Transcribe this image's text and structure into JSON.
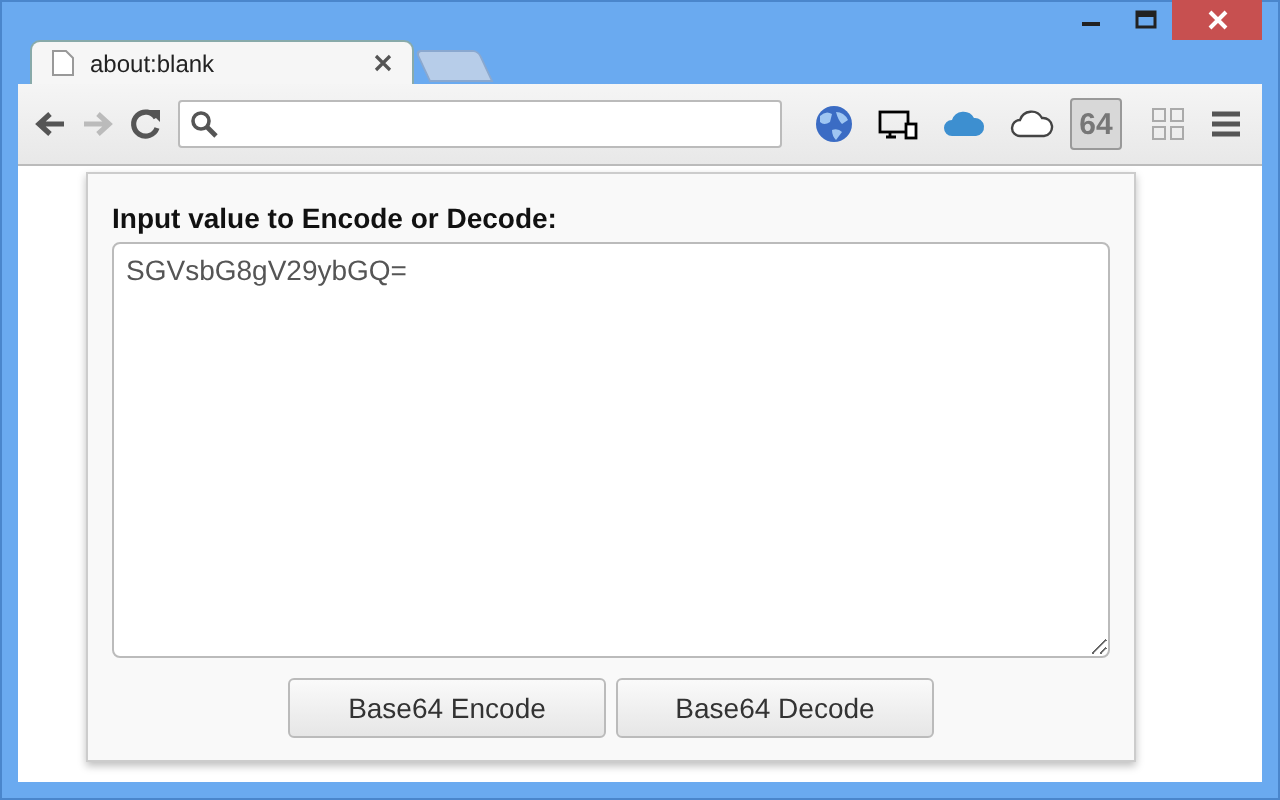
{
  "tabs": [
    {
      "title": "about:blank",
      "selected": true
    },
    {
      "selected": false
    }
  ],
  "extension_badge": {
    "label": "64",
    "selected": true
  },
  "popup": {
    "heading": "Input value to Encode or Decode:",
    "input": {
      "value": "SGVsbG8gV29ybGQ="
    },
    "buttons": [
      "Base64 Encode",
      "Base64 Decode"
    ]
  }
}
